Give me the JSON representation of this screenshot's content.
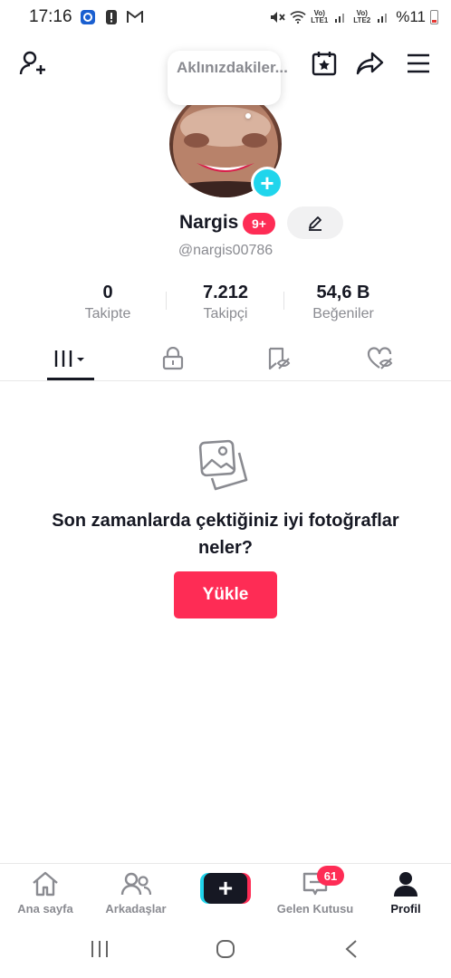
{
  "status_bar": {
    "time": "17:16",
    "battery_text": "%11",
    "lte1": "LTE1",
    "lte2": "LTE2",
    "volte1": "Vo)",
    "volte2": "Vo)"
  },
  "top_bar": {
    "icons": [
      "add-user-icon",
      "calendar-star-icon",
      "share-icon",
      "menu-icon"
    ]
  },
  "note_bubble": {
    "text": "Aklınızdakiler..."
  },
  "profile": {
    "display_name": "Nargis",
    "notification_badge": "9+",
    "username": "@nargis00786"
  },
  "stats": [
    {
      "value": "0",
      "label": "Takipte"
    },
    {
      "value": "7.212",
      "label": "Takipçi"
    },
    {
      "value": "54,6 B",
      "label": "Beğeniler"
    }
  ],
  "tabs": [
    {
      "name": "videos-grid",
      "active": true
    },
    {
      "name": "private",
      "active": false
    },
    {
      "name": "favorites",
      "active": false
    },
    {
      "name": "liked",
      "active": false
    }
  ],
  "empty_state": {
    "message": "Son zamanlarda çektiğiniz iyi fotoğraflar neler?",
    "button_label": "Yükle"
  },
  "bottom_nav": {
    "home": "Ana sayfa",
    "friends": "Arkadaşlar",
    "inbox": "Gelen Kutusu",
    "inbox_badge": "61",
    "profile": "Profil"
  },
  "colors": {
    "accent": "#fe2c55",
    "cyan": "#20d5ec",
    "text": "#161823",
    "muted": "#8a8b91"
  }
}
